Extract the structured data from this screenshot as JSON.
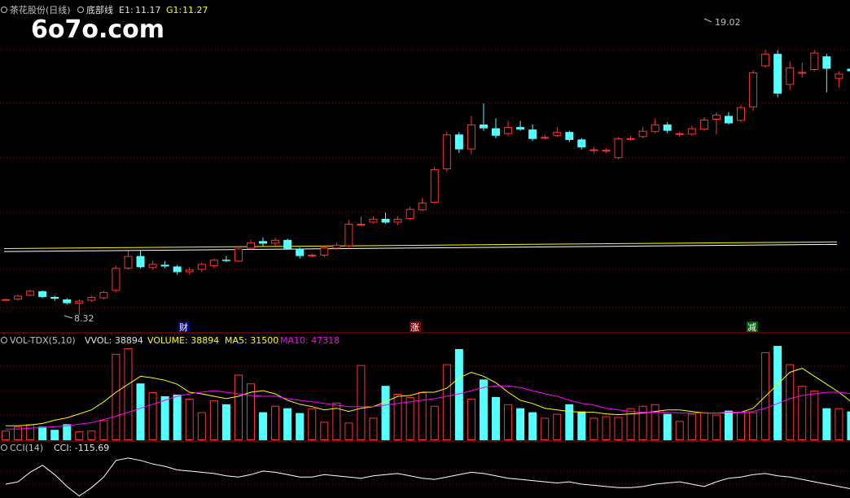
{
  "watermark": "6o7o.com",
  "header": {
    "stock": "茶花股份(日线)",
    "indicator": "底部线",
    "e1_label": "E1:",
    "e1_value": "11.17",
    "g1_label": "G1:",
    "g1_value": "11.27"
  },
  "price_labels": {
    "high": "19.02",
    "low": "8.32"
  },
  "markers": [
    "财",
    "涨",
    "减"
  ],
  "vol_header": {
    "name": "VOL-TDX(5,10)",
    "vvol": "VVOL: 38894",
    "volume": "VOLUME: 38894",
    "ma5": "MA5: 31500",
    "ma10": "MA10: 47318"
  },
  "cci_header": {
    "name": "CCI(14)",
    "value": "CCI: -115.69"
  },
  "colors": {
    "up": "#ff3232",
    "down": "#54ffff",
    "white": "#ffffff",
    "yellow": "#ffff00",
    "magenta": "#ff00ff",
    "grid": "#7a1010",
    "text": "#c0c0c0"
  },
  "chart_data": [
    {
      "type": "candlestick",
      "title": "茶花股份(日线)",
      "ylim": [
        7.9,
        20.3
      ],
      "series_lines": [
        {
          "name": "E1",
          "values": [
            10.88,
            11.17
          ]
        },
        {
          "name": "G1",
          "values": [
            11.0,
            11.27
          ]
        }
      ],
      "candles": [
        [
          8.95,
          8.96,
          8.98,
          8.93
        ],
        [
          8.95,
          9.1,
          9.14,
          8.9
        ],
        [
          9.1,
          9.3,
          9.35,
          9.08
        ],
        [
          9.28,
          9.05,
          9.32,
          9.0
        ],
        [
          9.05,
          8.98,
          9.1,
          8.9
        ],
        [
          8.95,
          8.8,
          9.0,
          8.75
        ],
        [
          8.78,
          8.9,
          8.95,
          8.32
        ],
        [
          8.9,
          9.05,
          9.1,
          8.85
        ],
        [
          9.0,
          9.25,
          9.3,
          8.95
        ],
        [
          9.3,
          10.22,
          10.3,
          9.25
        ],
        [
          10.2,
          10.7,
          10.9,
          10.15
        ],
        [
          10.7,
          10.25,
          10.95,
          10.2
        ],
        [
          10.22,
          10.38,
          10.5,
          10.15
        ],
        [
          10.35,
          10.28,
          10.5,
          10.2
        ],
        [
          10.28,
          10.05,
          10.35,
          9.95
        ],
        [
          10.05,
          10.15,
          10.25,
          9.95
        ],
        [
          10.15,
          10.38,
          10.45,
          10.05
        ],
        [
          10.3,
          10.55,
          10.6,
          10.2
        ],
        [
          10.55,
          10.5,
          10.7,
          10.45
        ],
        [
          10.48,
          11.0,
          11.1,
          10.45
        ],
        [
          11.0,
          11.25,
          11.35,
          10.95
        ],
        [
          11.3,
          11.2,
          11.45,
          11.1
        ],
        [
          11.2,
          11.35,
          11.45,
          11.1
        ],
        [
          11.35,
          11.0,
          11.4,
          10.95
        ],
        [
          11.0,
          10.7,
          11.05,
          10.6
        ],
        [
          10.72,
          10.75,
          10.8,
          10.65
        ],
        [
          10.72,
          11.05,
          11.1,
          10.65
        ],
        [
          11.0,
          11.15,
          11.25,
          10.95
        ],
        [
          11.1,
          12.0,
          12.15,
          11.0
        ],
        [
          12.0,
          12.0,
          12.3,
          11.9
        ],
        [
          12.05,
          12.2,
          12.3,
          12.0
        ],
        [
          12.2,
          12.05,
          12.45,
          12.0
        ],
        [
          12.05,
          12.2,
          12.3,
          11.95
        ],
        [
          12.2,
          12.6,
          12.7,
          12.15
        ],
        [
          12.55,
          12.85,
          13.05,
          12.5
        ],
        [
          12.85,
          14.2,
          14.3,
          12.8
        ],
        [
          14.2,
          15.6,
          15.7,
          14.1
        ],
        [
          15.6,
          15.0,
          15.7,
          14.85
        ],
        [
          15.0,
          16.0,
          16.35,
          14.8
        ],
        [
          16.0,
          15.85,
          16.85,
          15.75
        ],
        [
          15.85,
          15.55,
          16.25,
          15.45
        ],
        [
          15.62,
          15.9,
          16.15,
          15.55
        ],
        [
          15.9,
          15.8,
          16.15,
          15.75
        ],
        [
          15.8,
          15.42,
          16.0,
          15.35
        ],
        [
          15.45,
          15.5,
          15.6,
          15.4
        ],
        [
          15.55,
          15.7,
          15.9,
          15.5
        ],
        [
          15.7,
          15.38,
          15.75,
          15.3
        ],
        [
          15.4,
          15.08,
          15.45,
          15.0
        ],
        [
          15.0,
          15.0,
          15.1,
          14.85
        ],
        [
          14.95,
          14.98,
          15.05,
          14.85
        ],
        [
          14.65,
          15.45,
          15.5,
          14.6
        ],
        [
          15.4,
          15.45,
          15.55,
          15.35
        ],
        [
          15.5,
          15.75,
          15.9,
          15.45
        ],
        [
          15.7,
          16.0,
          16.25,
          15.65
        ],
        [
          16.0,
          15.75,
          16.1,
          15.65
        ],
        [
          15.62,
          15.65,
          15.7,
          15.5
        ],
        [
          15.6,
          15.85,
          15.95,
          15.55
        ],
        [
          15.8,
          16.2,
          16.3,
          15.75
        ],
        [
          16.2,
          16.4,
          16.5,
          15.6
        ],
        [
          16.35,
          16.05,
          16.5,
          16.0
        ],
        [
          16.15,
          16.7,
          16.8,
          16.1
        ],
        [
          16.7,
          18.1,
          18.2,
          16.55
        ],
        [
          18.35,
          18.85,
          19.02,
          18.3
        ],
        [
          18.85,
          17.25,
          19.0,
          17.1
        ],
        [
          17.6,
          18.3,
          18.55,
          17.4
        ],
        [
          18.1,
          18.12,
          18.5,
          17.9
        ],
        [
          18.2,
          18.9,
          19.0,
          18.15
        ],
        [
          18.75,
          18.25,
          18.85,
          17.3
        ],
        [
          17.85,
          18.05,
          18.15,
          17.5
        ],
        [
          18.25,
          18.15,
          18.3,
          17.65
        ],
        [
          18.3,
          18.05,
          18.55,
          18.0
        ],
        [
          18.05,
          17.6,
          18.1,
          17.55
        ],
        [
          17.45,
          17.45,
          17.55,
          17.4
        ],
        [
          17.55,
          17.15,
          17.6,
          16.85
        ]
      ]
    },
    {
      "type": "bar",
      "title": "VOL-TDX(5,10)",
      "ylim": [
        0,
        115000
      ],
      "values": [
        12000,
        17000,
        20000,
        17000,
        13000,
        20000,
        11000,
        12000,
        25000,
        108000,
        115000,
        71000,
        60000,
        55000,
        57000,
        52000,
        35000,
        50000,
        45000,
        82000,
        71000,
        35000,
        43000,
        40000,
        34000,
        40000,
        23000,
        47000,
        22000,
        94000,
        28000,
        68000,
        58000,
        54000,
        60000,
        43000,
        95000,
        114000,
        52000,
        76000,
        54000,
        45000,
        40000,
        35000,
        28000,
        33000,
        45000,
        36000,
        28000,
        30000,
        29000,
        40000,
        43000,
        45000,
        33000,
        24000,
        33000,
        35000,
        32000,
        37000,
        35000,
        35000,
        110000,
        118000,
        95000,
        68000,
        62000,
        40000,
        40000,
        36000,
        31000,
        38000,
        38000,
        42000
      ],
      "series": [
        {
          "name": "VOLUME",
          "values": []
        },
        {
          "name": "MA5",
          "values": [
            18000,
            18000,
            19000,
            21000,
            25000,
            28000,
            33000,
            38000,
            48000,
            60000,
            70000,
            80000,
            78000,
            75000,
            70000,
            60000,
            58000,
            55000,
            52000,
            55000,
            60000,
            62000,
            58000,
            50000,
            45000,
            42000,
            38000,
            40000,
            36000,
            40000,
            42000,
            48000,
            55000,
            56000,
            60000,
            60000,
            65000,
            78000,
            85000,
            80000,
            72000,
            60000,
            50000,
            46000,
            40000,
            38000,
            36000,
            35000,
            35000,
            33000,
            32000,
            33000,
            34000,
            36000,
            38000,
            38000,
            36000,
            34000,
            34000,
            34000,
            35000,
            40000,
            55000,
            70000,
            85000,
            90000,
            80000,
            70000,
            60000,
            48000,
            40000,
            36000,
            34000,
            31500
          ]
        },
        {
          "name": "MA10",
          "values": [
            14000,
            14000,
            15000,
            16000,
            17000,
            18000,
            20000,
            22000,
            26000,
            30000,
            35000,
            40000,
            45000,
            50000,
            55000,
            58000,
            60000,
            62000,
            60000,
            58000,
            56000,
            55000,
            55000,
            52000,
            50000,
            48000,
            46000,
            44000,
            42000,
            42000,
            42000,
            44000,
            46000,
            48000,
            50000,
            52000,
            55000,
            58000,
            62000,
            66000,
            68000,
            68000,
            66000,
            62000,
            58000,
            55000,
            50000,
            46000,
            44000,
            40000,
            38000,
            36000,
            35000,
            35000,
            35000,
            34000,
            34000,
            34000,
            34000,
            35000,
            35000,
            36000,
            40000,
            46000,
            52000,
            56000,
            58000,
            60000,
            60000,
            58000,
            57000,
            55000,
            52000,
            47318
          ]
        }
      ]
    },
    {
      "type": "line",
      "title": "CCI(14)",
      "ylim": [
        -150,
        200
      ],
      "series": [
        {
          "name": "CCI",
          "values": [
            -40,
            -20,
            60,
            120,
            40,
            -60,
            -140,
            -70,
            20,
            160,
            180,
            160,
            130,
            110,
            80,
            70,
            60,
            50,
            30,
            20,
            40,
            70,
            60,
            40,
            20,
            20,
            40,
            30,
            20,
            10,
            30,
            40,
            50,
            30,
            10,
            0,
            20,
            40,
            60,
            50,
            30,
            10,
            0,
            -10,
            -20,
            -30,
            -20,
            -40,
            -50,
            -60,
            -70,
            -70,
            -60,
            -40,
            -30,
            -20,
            -40,
            -60,
            -20,
            10,
            20,
            40,
            50,
            30,
            20,
            0,
            -20,
            -40,
            -60,
            -80,
            -90,
            -100,
            -110,
            -115.69
          ]
        }
      ]
    }
  ]
}
